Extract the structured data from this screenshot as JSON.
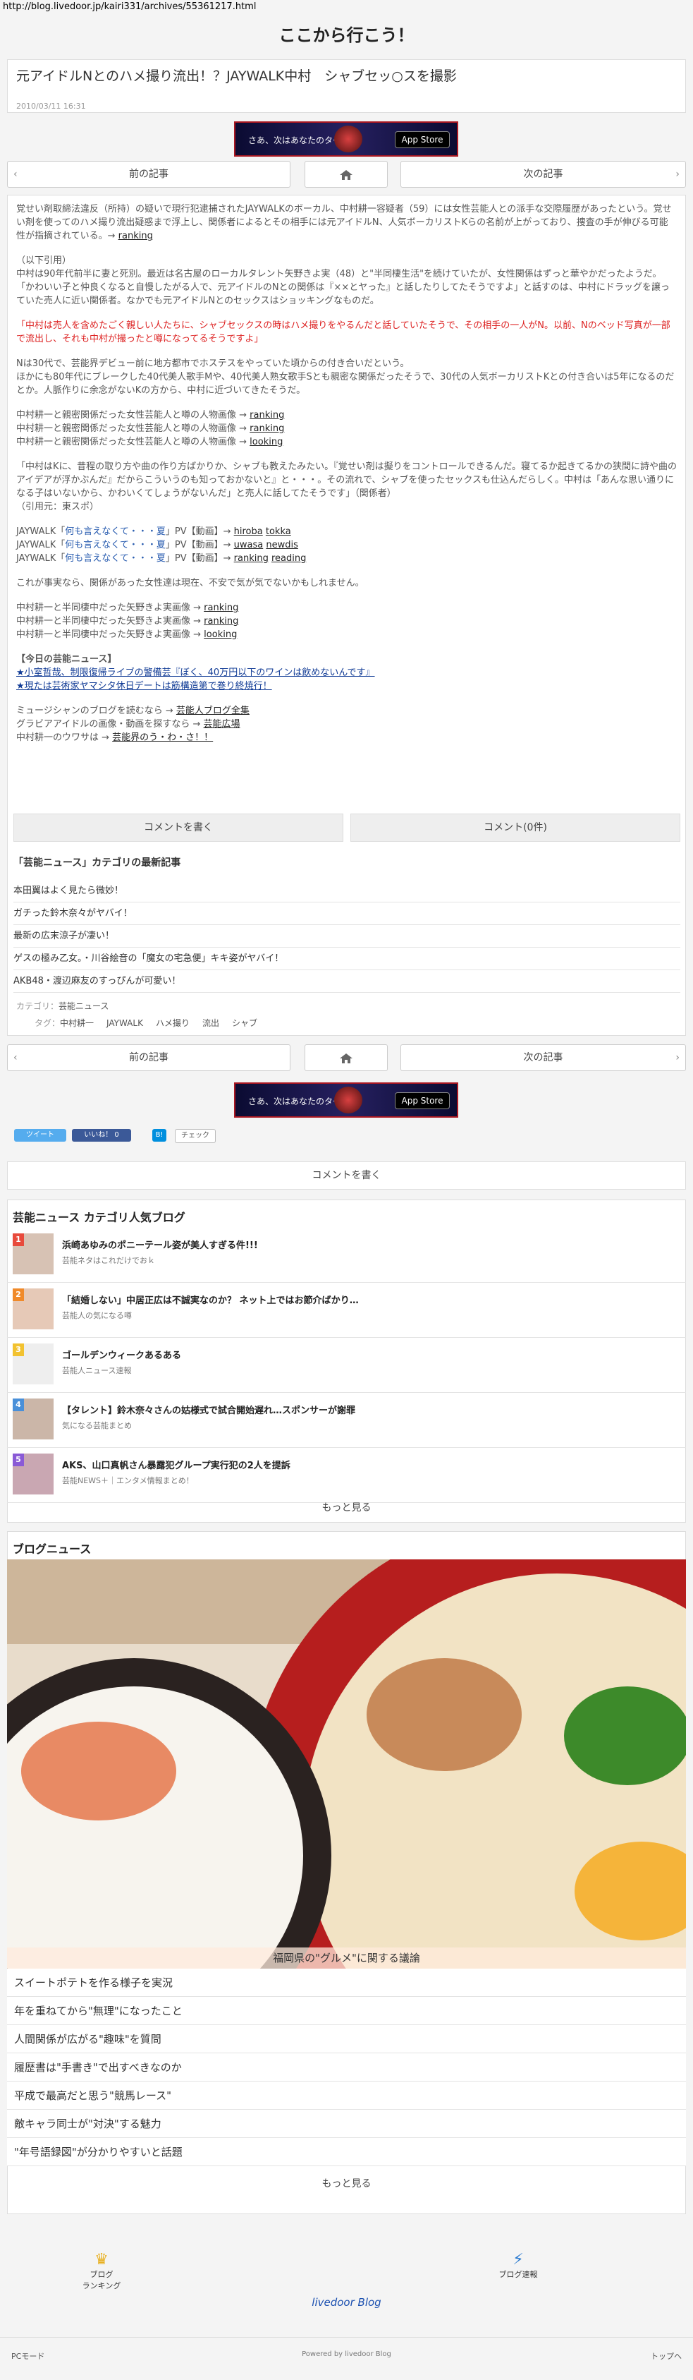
{
  "browser": {
    "url": "http://blog.livedoor.jp/kairi331/archives/55361217.html"
  },
  "site": {
    "title": "ここから行こう！"
  },
  "article": {
    "title": "元アイドルNとのハメ撮り流出！？JAYWALK中村　シャブセッ○スを撮影",
    "date": "2010/03/11 16:31"
  },
  "banner": {
    "text": "さあ、次はあなたのターン",
    "store": "App Store"
  },
  "pager": {
    "prev": "前の記事",
    "next": "次の記事"
  },
  "body": {
    "p1": "覚せい剤取締法違反（所持）の疑いで現行犯逮捕されたJAYWALKのボーカル、中村耕一容疑者（59）には女性芸能人との派手な交際履歴があったという。覚せい剤を使ってのハメ撮り流出疑惑まで浮上し、関係者によるとその相手には元アイドルN、人気ボーカリストKらの名前が上がっており、捜査の手が伸びる可能性が指摘されている。→",
    "p1_link": "ranking",
    "p2a": "（以下引用）",
    "p2b": "中村は90年代前半に妻と死別。最近は名古屋のローカルタレント矢野きよ実（48）と\"半同棲生活\"を続けていたが、女性関係はずっと華やかだったようだ。",
    "p2c": "「かわいい子と仲良くなると自慢したがる人で、元アイドルのNとの関係は『××とヤった』と話したりしてたそうですよ」と話すのは、中村にドラッグを譲っていた売人に近い関係者。なかでも元アイドルNとのセックスはショッキングなものだ。",
    "p3": "「中村は売人を含めたごく親しい人たちに、シャブセックスの時はハメ撮りをやるんだと話していたそうで、その相手の一人がN。以前、Nのベッド写真が一部で流出し、それも中村が撮ったと噂になってるそうですよ」",
    "p4a": "Nは30代で、芸能界デビュー前に地方都市でホステスをやっていた頃からの付き合いだという。",
    "p4b": "ほかにも80年代にブレークした40代美人歌手Mや、40代美人熟女歌手Sとも親密な関係だったそうで、30代の人気ボーカリストKとの付き合いは5年になるのだとか。人脈作りに余念がないKの方から、中村に近づいてきたそうだ。",
    "links1": [
      {
        "text": "中村耕一と親密関係だった女性芸能人と噂の人物画像 →",
        "link": "ranking"
      },
      {
        "text": "中村耕一と親密関係だった女性芸能人と噂の人物画像 →",
        "link": "ranking"
      },
      {
        "text": "中村耕一と親密関係だった女性芸能人と噂の人物画像 →",
        "link": "looking"
      }
    ],
    "p5": "「中村はKに、昔程の取り方や曲の作り方ばかりか、シャブも教えたみたい。『覚せい剤は擬りをコントロールできるんだ。寝てるか起きてるかの狭間に詩や曲のアイデアが浮かぶんだ』だからこういうのも知っておかないと』と・・・。その流れで、シャブを使ったセックスも仕込んだらしく。中村は「あんな思い通りになる子はいないから、かわいくてしょうがないんだ」と売人に話してたそうです」（関係者）",
    "p5b": "（引用元：東スポ）",
    "pv": [
      {
        "prefix": "JAYWALK「",
        "title": "何も言えなくて・・・夏",
        "suffix": "」PV【動画】→",
        "links": [
          "hiroba",
          "tokka"
        ]
      },
      {
        "prefix": "JAYWALK「",
        "title": "何も言えなくて・・・夏",
        "suffix": "」PV【動画】→",
        "links": [
          "uwasa",
          "newdis"
        ]
      },
      {
        "prefix": "JAYWALK「",
        "title": "何も言えなくて・・・夏",
        "suffix": "」PV【動画】→",
        "links": [
          "ranking",
          "reading"
        ]
      }
    ],
    "p6": "これが事実なら、関係があった女性達は現在、不安で気が気でないかもしれません。",
    "links2": [
      {
        "text": "中村耕一と半同棲中だった矢野きよ実画像 →",
        "link": "ranking"
      },
      {
        "text": "中村耕一と半同棲中だった矢野きよ実画像 →",
        "link": "ranking"
      },
      {
        "text": "中村耕一と半同棲中だった矢野きよ実画像 →",
        "link": "looking"
      }
    ],
    "today_head": "【今日の芸能ニュース】",
    "today1": "★小室哲哉、制限復帰ライブの警備芸『ぼく、40万円以下のワインは飲めないんです』",
    "today2": "★現たは芸術家ヤマシタ休日デートは筋構造第で巻り終焼行！",
    "more1_text": "ミュージシャンのブログを読むなら →",
    "more1_link": "芸能人ブログ全集",
    "more2_text": "グラビアアイドルの画像・動画を探すなら →",
    "more2_link": "芸能広場",
    "more3_text": "中村耕一のウワサは →",
    "more3_link": "芸能界のう・わ・さ！！"
  },
  "comments": {
    "write": "コメントを書く",
    "count": "コメント(0件)"
  },
  "latest": {
    "title": "「芸能ニュース」カテゴリの最新記事",
    "items": [
      "本田翼はよく見たら微妙！",
      "ガチった鈴木奈々がヤバイ！",
      "最新の広末涼子が凄い！",
      "ゲスの極み乙女。・川谷絵音の「魔女の宅急便」キキ姿がヤバイ！",
      "AKB48・渡辺麻友のすっぴんが可愛い！"
    ]
  },
  "meta": {
    "category_label": "カテゴリ：",
    "category": "芸能ニュース",
    "tags_label": "タグ：",
    "tags": [
      "中村耕一",
      "JAYWALK",
      "ハメ撮り",
      "流出",
      "シャブ"
    ]
  },
  "social": {
    "tweet": "ツイート",
    "like": "いいね！ 0",
    "hatena": "B!",
    "check": "チェック"
  },
  "ranking": {
    "title": "芸能ニュース カテゴリ人気ブログ",
    "items": [
      {
        "num": "1",
        "title": "浜崎あゆみのポニーテール姿が美人すぎる件!!!",
        "sub": "芸能ネタはこれだけでおｋ"
      },
      {
        "num": "2",
        "title": "「結婚しない」中居正広は不誠実なのか？ ネット上ではお節介ばかり…",
        "sub": "芸能人の気になる噂"
      },
      {
        "num": "3",
        "title": "ゴールデンウィークあるある",
        "sub": "芸能人ニュース速報"
      },
      {
        "num": "4",
        "title": "【タレント】鈴木奈々さんの姑様式で試合開始遅れ…スポンサーが謝罪",
        "sub": "気になる芸能まとめ"
      },
      {
        "num": "5",
        "title": "AKS、山口真帆さん暴露犯グループ実行犯の2人を提訴",
        "sub": "芸能NEWS＋｜エンタメ情報まとめ！"
      }
    ],
    "more": "もっと見る"
  },
  "blognews": {
    "title": "ブログニュース",
    "caption": "福岡県の\"グルメ\"に関する議論",
    "items": [
      "スイートポテトを作る様子を実況",
      "年を重ねてから\"無理\"になったこと",
      "人間関係が広がる\"趣味\"を質問",
      "履歴書は\"手書き\"で出すべきなのか",
      "平成で最高だと思う\"競馬レース\"",
      "敵キャラ同士が\"対決\"する魅力",
      "\"年号語録図\"が分かりやすいと話題"
    ],
    "more": "もっと見る"
  },
  "footer": {
    "blog_ranking": "ブログ\nランキング",
    "blog_news": "ブログ速報",
    "logo": "livedoor Blog",
    "pc_mode": "PCモード",
    "powered": "Powered by livedoor Blog",
    "to_top": "トップへ"
  },
  "colors": {
    "accent_red": "#d22222",
    "link_blue": "#2a5db0",
    "twitter": "#55acee",
    "facebook": "#3b5998"
  }
}
